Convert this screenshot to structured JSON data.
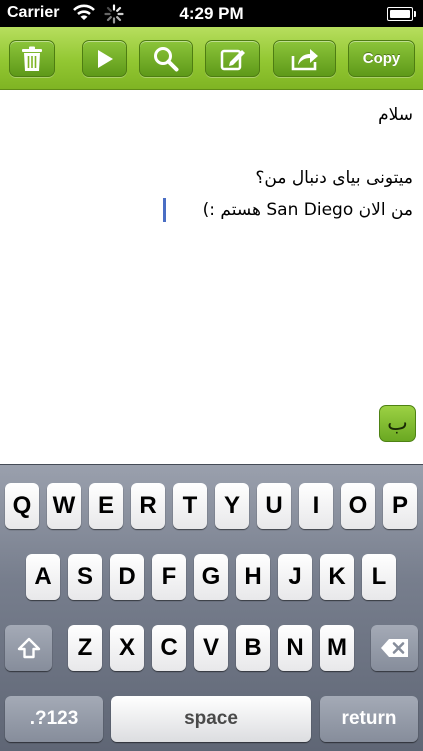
{
  "status_bar": {
    "carrier": "Carrier",
    "time": "4:29 PM"
  },
  "toolbar": {
    "buttons": [
      {
        "name": "trash-button",
        "icon": "trash-icon"
      },
      {
        "name": "play-button",
        "icon": "play-icon"
      },
      {
        "name": "search-button",
        "icon": "search-icon"
      },
      {
        "name": "edit-button",
        "icon": "edit-icon"
      },
      {
        "name": "share-button",
        "icon": "share-icon"
      }
    ],
    "copy_label": "Copy"
  },
  "editor": {
    "lines": [
      "سلام",
      "میتونی بیای دنبال من؟",
      "من الان San Diego هستم :)"
    ],
    "language_button": "ب"
  },
  "keyboard": {
    "row1": [
      "Q",
      "W",
      "E",
      "R",
      "T",
      "Y",
      "U",
      "I",
      "O",
      "P"
    ],
    "row2": [
      "A",
      "S",
      "D",
      "F",
      "G",
      "H",
      "J",
      "K",
      "L"
    ],
    "row3": [
      "Z",
      "X",
      "C",
      "V",
      "B",
      "N",
      "M"
    ],
    "numbers_label": ".?123",
    "space_label": "space",
    "return_label": "return"
  },
  "colors": {
    "toolbar_green": "#92c732",
    "cursor_blue": "#4a6ec4"
  }
}
